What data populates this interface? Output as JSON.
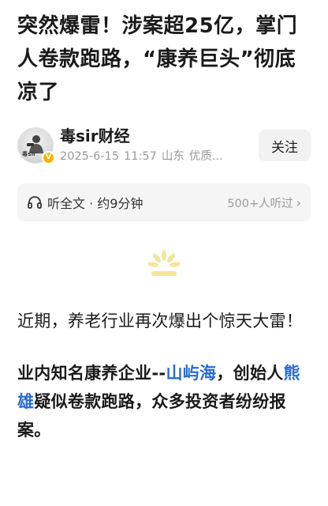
{
  "article": {
    "title": "突然爆雷！涉案超25亿，掌门人卷款跑路，“康养巨头”彻底凉了"
  },
  "author": {
    "name": "毒sir财经",
    "avatar_logo": "毒sir",
    "verified_glyph": "V",
    "date": "2025-6-15",
    "time": "11:57",
    "location": "山东",
    "tag": "优质..."
  },
  "follow": {
    "label": "关注"
  },
  "listen": {
    "label": "听全文 · 约9分钟",
    "count": "500+人听过",
    "chevron": "›"
  },
  "content": {
    "para1": "近期，养老行业再次爆出个惊天大雷！",
    "para2": {
      "t1": "业内知名康养企业--",
      "link1": "山屿海",
      "t2": "，创始人",
      "link2": "熊雄",
      "t3": "疑似卷款跑路，众多投资者纷纷报案。"
    }
  },
  "colors": {
    "link": "#2a6bd1",
    "loading": "#f4e59a",
    "verified": "#f5b400"
  },
  "icons": [
    "headphone-icon",
    "loading-icon",
    "verified-icon",
    "chevron-right-icon"
  ]
}
